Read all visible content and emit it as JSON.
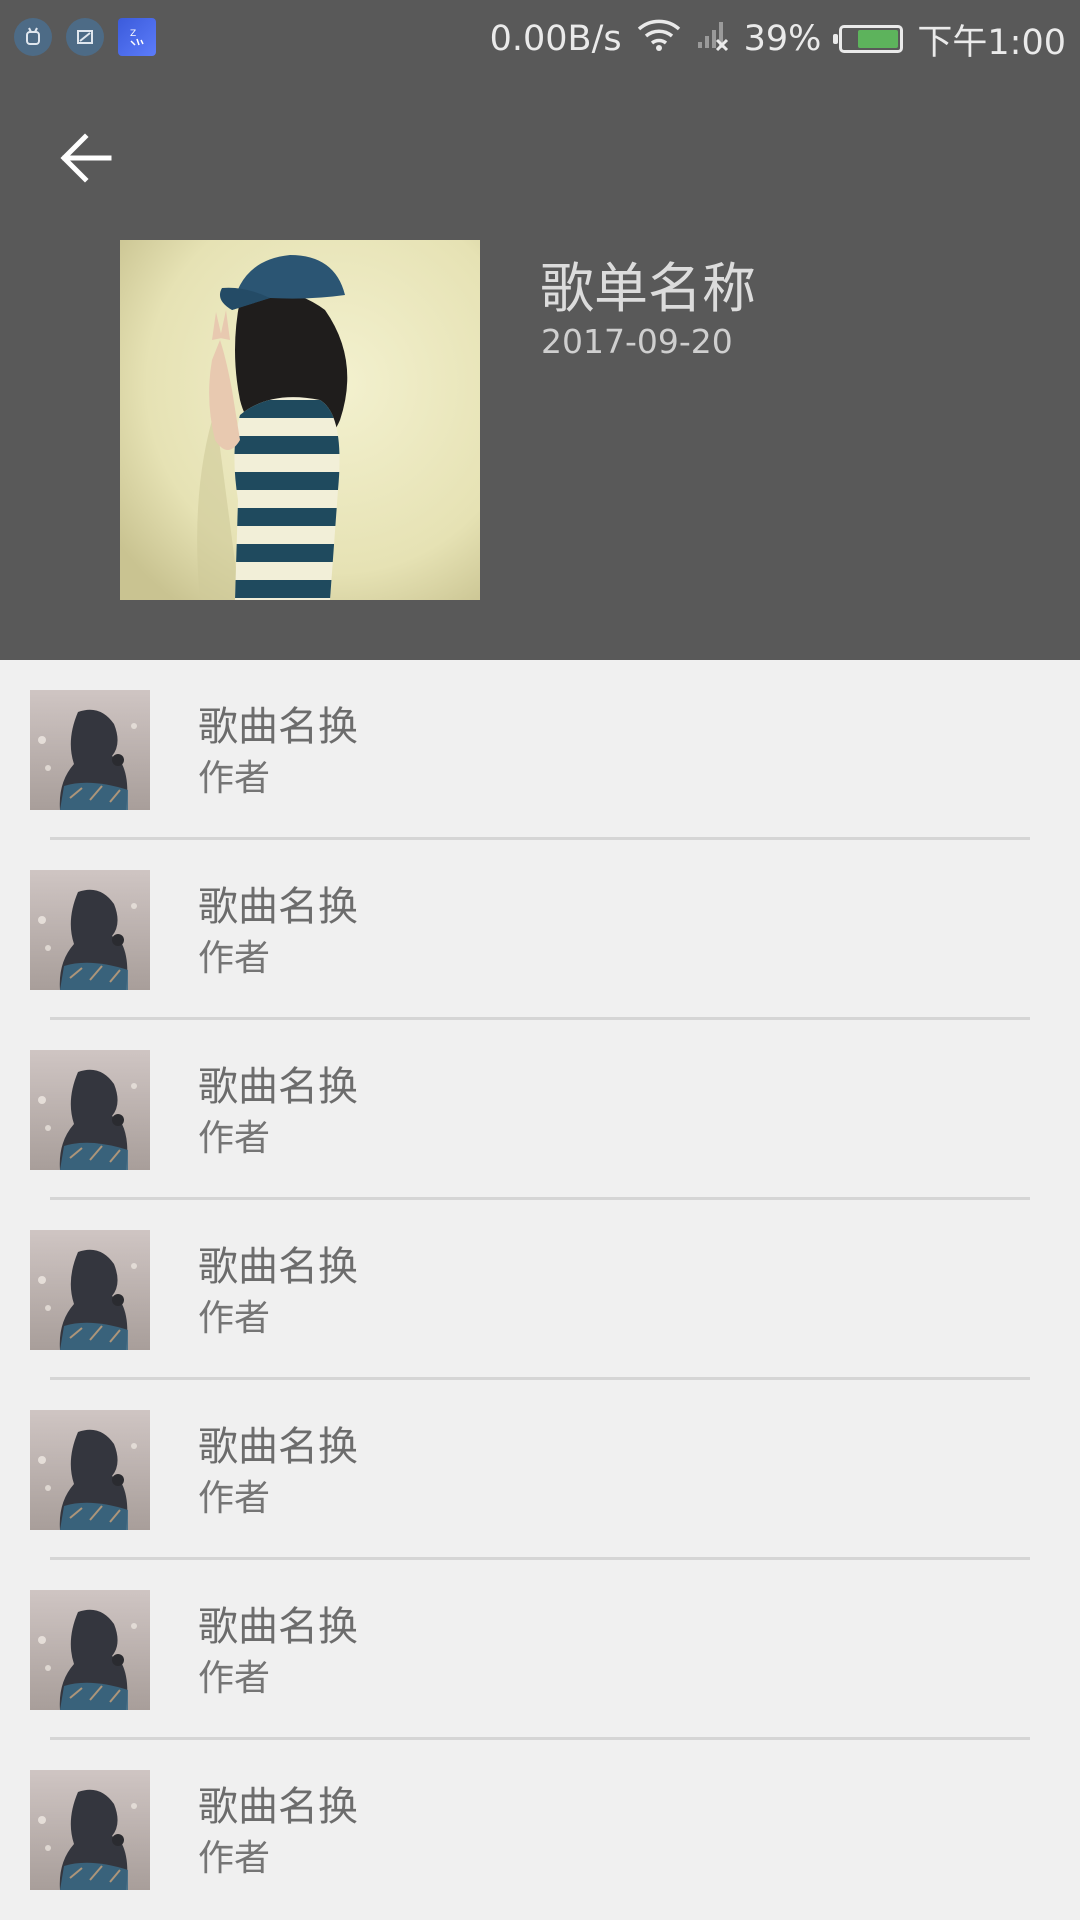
{
  "status_bar": {
    "net_speed": "0.00B/s",
    "battery_percent": "39%",
    "battery_level": 0.39,
    "time": "下午1:00",
    "icons": [
      "android-debug-icon",
      "screenshot-icon",
      "app-notification-icon",
      "wifi-icon",
      "no-signal-icon",
      "battery-icon"
    ]
  },
  "header": {
    "back_icon": "arrow-left-icon",
    "playlist_title": "歌单名称",
    "playlist_date": "2017-09-20",
    "cover_image": "girl-in-cap-striped-shirt-photo"
  },
  "songs": [
    {
      "name": "歌曲名换",
      "artist": "作者"
    },
    {
      "name": "歌曲名换",
      "artist": "作者"
    },
    {
      "name": "歌曲名换",
      "artist": "作者"
    },
    {
      "name": "歌曲名换",
      "artist": "作者"
    },
    {
      "name": "歌曲名换",
      "artist": "作者"
    },
    {
      "name": "歌曲名换",
      "artist": "作者"
    },
    {
      "name": "歌曲名换",
      "artist": "作者"
    }
  ],
  "colors": {
    "header_bg": "#595959",
    "list_bg": "#f0f0f0",
    "battery_fill": "#5db35c",
    "divider": "#d5d5d5"
  }
}
